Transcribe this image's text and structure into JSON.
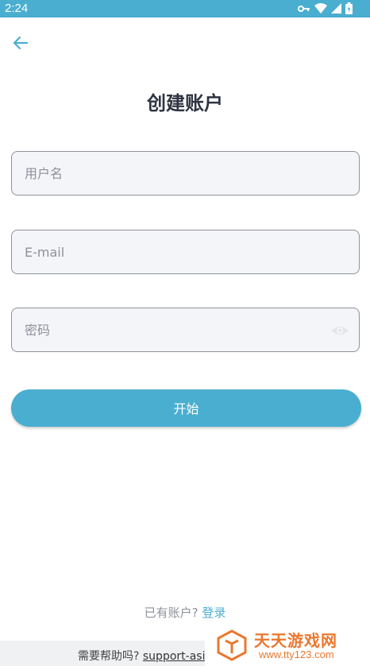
{
  "status_bar": {
    "time": "2:24"
  },
  "header": {
    "title": "创建账户"
  },
  "form": {
    "username_placeholder": "用户名",
    "email_placeholder": "E-mail",
    "password_placeholder": "密码",
    "submit_label": "开始"
  },
  "footer": {
    "have_account": "已有账户?",
    "login_label": "登录",
    "help_prefix": "需要帮助吗?",
    "help_link": "support-asi"
  },
  "watermark": {
    "title": "天天游戏网",
    "url": "www.tty123.com"
  },
  "colors": {
    "accent": "#4aaed0",
    "watermark": "#e9782f"
  }
}
